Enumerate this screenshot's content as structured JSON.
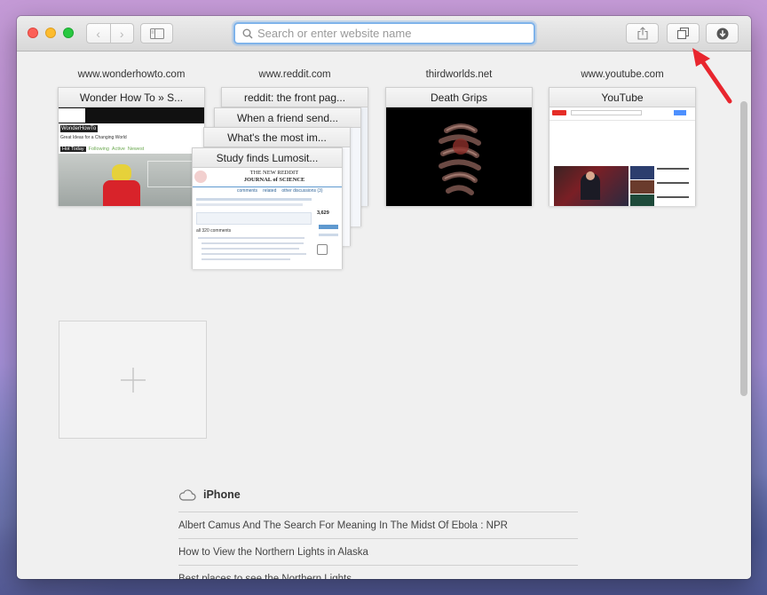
{
  "search": {
    "placeholder": "Search or enter website name"
  },
  "top_sites": [
    {
      "domain": "www.wonderhowto.com",
      "title": "Wonder How To » S..."
    },
    {
      "domain": "www.reddit.com",
      "titles": [
        "reddit: the front pag...",
        "When a friend send...",
        "What's the most im...",
        "Study finds Lumosit..."
      ]
    },
    {
      "domain": "thirdworlds.net",
      "title": "Death Grips"
    },
    {
      "domain": "www.youtube.com",
      "title": "YouTube"
    }
  ],
  "thumbs": {
    "wonderhowto": {
      "logo": "WonderHowTo",
      "tagline": "Great Ideas for a Changing World",
      "tabs": [
        "Hot Today",
        "Following",
        "Active",
        "Newest"
      ]
    },
    "reddit": {
      "masthead_1": "THE NEW REDDIT",
      "masthead_2": "JOURNAL of SCIENCE",
      "subtabs": [
        "comments",
        "related",
        "other discussions (3)"
      ],
      "comment_count": "all 320 comments",
      "score": "3,629"
    }
  },
  "icloud": {
    "device": "iPhone",
    "tabs": [
      "Albert Camus And The Search For Meaning In The Midst Of Ebola : NPR",
      "How to View the Northern Lights in Alaska",
      "Best places to see the Northern Lights"
    ]
  },
  "colors": {
    "accent": "#7fb3ea",
    "arrow": "#e8262e"
  }
}
